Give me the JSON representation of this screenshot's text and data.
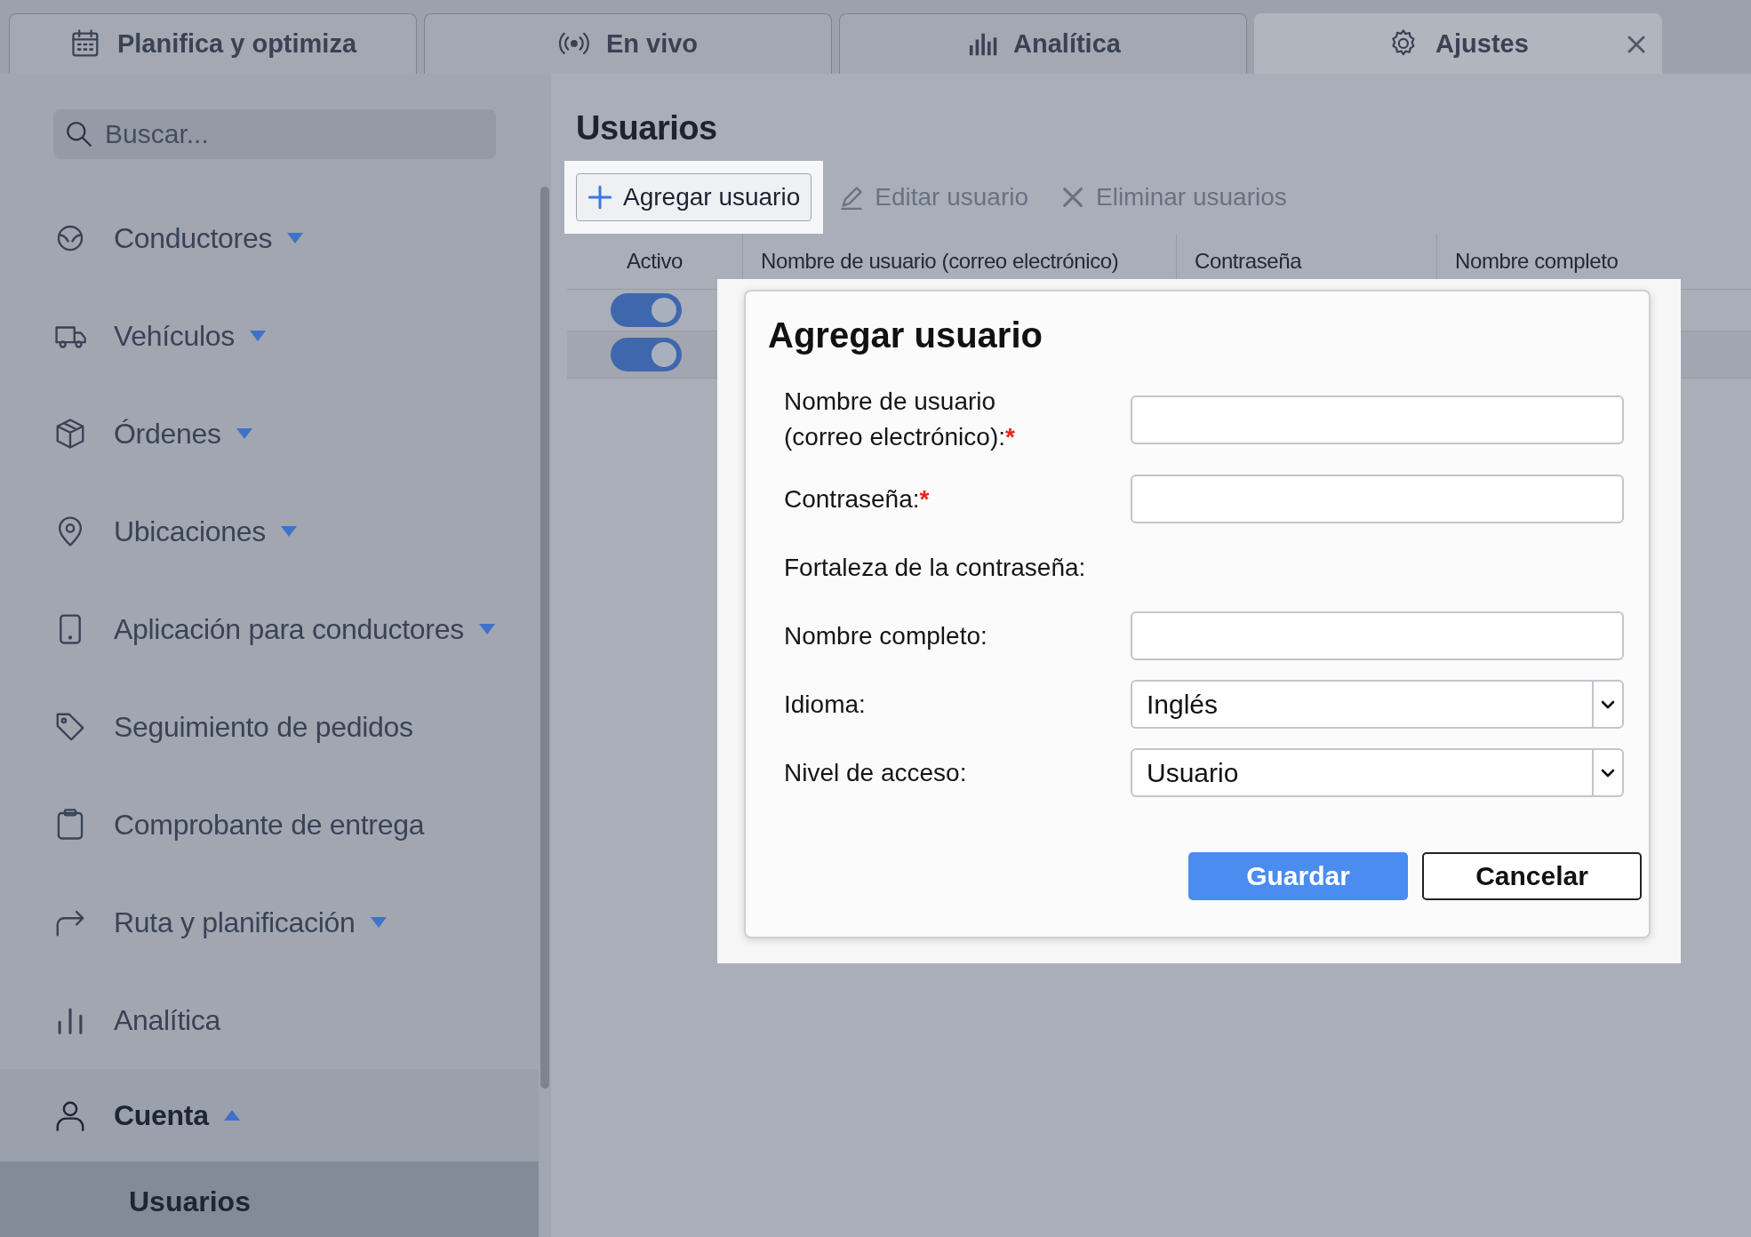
{
  "tabs": [
    {
      "label": "Planifica y optimiza",
      "selected": false,
      "closable": false
    },
    {
      "label": "En vivo",
      "selected": false,
      "closable": false
    },
    {
      "label": "Analítica",
      "selected": false,
      "closable": false
    },
    {
      "label": "Ajustes",
      "selected": true,
      "closable": true
    }
  ],
  "sidebar": {
    "search": {
      "placeholder": "Buscar..."
    },
    "items": [
      {
        "label": "Conductores",
        "kind": "group",
        "expanded": false
      },
      {
        "label": "Vehículos",
        "kind": "group",
        "expanded": false
      },
      {
        "label": "Órdenes",
        "kind": "group",
        "expanded": false
      },
      {
        "label": "Ubicaciones",
        "kind": "group",
        "expanded": false
      },
      {
        "label": "Aplicación para conductores",
        "kind": "group",
        "expanded": false
      },
      {
        "label": "Seguimiento de pedidos",
        "kind": "link"
      },
      {
        "label": "Comprobante de entrega",
        "kind": "link"
      },
      {
        "label": "Ruta y planificación",
        "kind": "group",
        "expanded": false
      },
      {
        "label": "Analítica",
        "kind": "link"
      },
      {
        "label": "Cuenta",
        "kind": "group",
        "expanded": true,
        "children": [
          {
            "label": "Usuarios",
            "selected": true
          }
        ]
      }
    ]
  },
  "page": {
    "title": "Usuarios",
    "toolbar": [
      {
        "label": "Agregar usuario",
        "disabled": false
      },
      {
        "label": "Editar usuario",
        "disabled": true
      },
      {
        "label": "Eliminar usuarios",
        "disabled": true
      }
    ],
    "table": {
      "columns": [
        "Activo",
        "Nombre de usuario (correo electrónico)",
        "Contraseña",
        "Nombre completo"
      ],
      "rows": [
        {
          "active": true
        },
        {
          "active": true
        }
      ]
    }
  },
  "dialog": {
    "title": "Agregar usuario",
    "fields": [
      {
        "kind": "text",
        "label": "Nombre de usuario (correo electrónico):",
        "required_mark": "*"
      },
      {
        "kind": "text",
        "label": "Contraseña:",
        "required_mark": "*"
      },
      {
        "kind": "info",
        "label": "Fortaleza de la contraseña:"
      },
      {
        "kind": "text",
        "label": "Nombre completo:"
      },
      {
        "kind": "select",
        "label": "Idioma:",
        "value": "Inglés"
      },
      {
        "kind": "select",
        "label": "Nivel de acceso:",
        "value": "Usuario"
      }
    ],
    "buttons": [
      {
        "label": "Guardar",
        "kind": "primary"
      },
      {
        "label": "Cancelar",
        "kind": "secondary"
      }
    ]
  }
}
